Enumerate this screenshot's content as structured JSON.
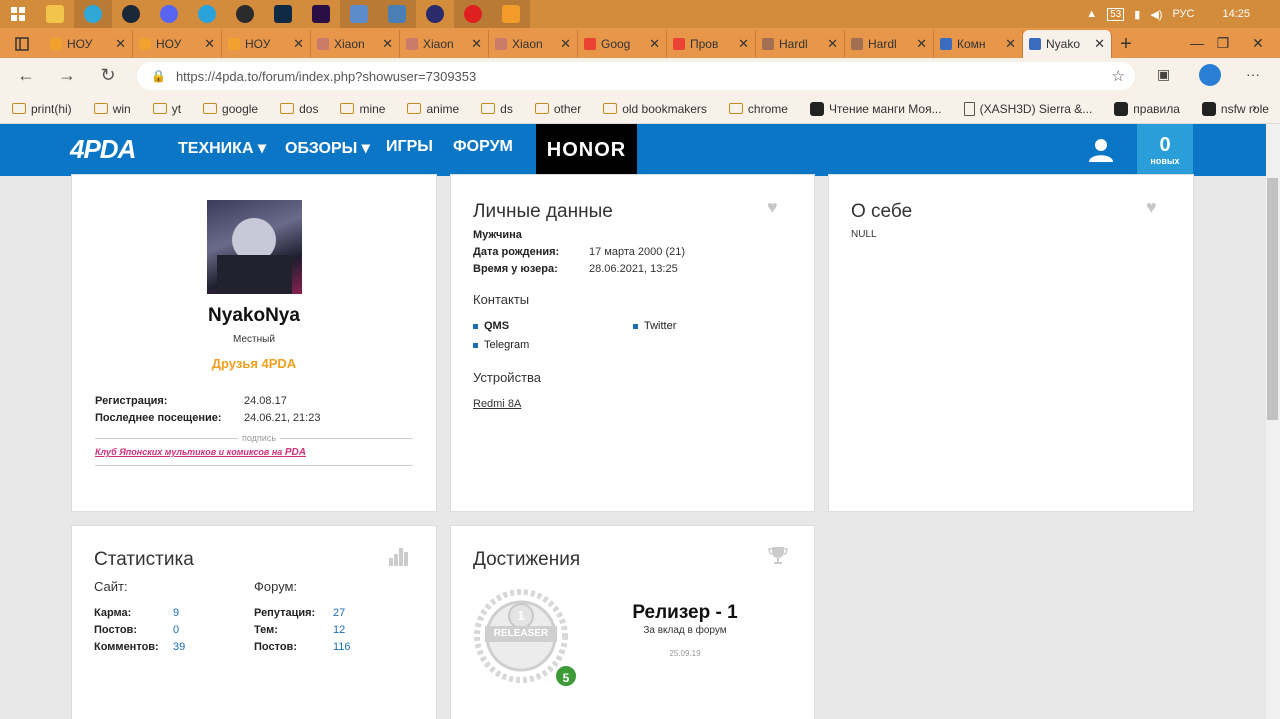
{
  "taskbar": {
    "lang": "РУС",
    "time": "14:25",
    "battery": "53"
  },
  "tabs": [
    {
      "label": "НОУ",
      "color": "#f2a12f"
    },
    {
      "label": "НОУ",
      "color": "#f2a12f"
    },
    {
      "label": "НОУ",
      "color": "#f2a12f"
    },
    {
      "label": "Xiaon",
      "color": "#c97b6a"
    },
    {
      "label": "Xiaon",
      "color": "#c97b6a"
    },
    {
      "label": "Xiaon",
      "color": "#c97b6a"
    },
    {
      "label": "Goog",
      "color": "#ea4335"
    },
    {
      "label": "Пров",
      "color": "#ea4335"
    },
    {
      "label": "Hardl",
      "color": "#a07050"
    },
    {
      "label": "Hardl",
      "color": "#a07050"
    },
    {
      "label": "Комн",
      "color": "#3a6bbf"
    },
    {
      "label": "Nyako",
      "color": "#3a6bbf"
    }
  ],
  "browser": {
    "url": "https://4pda.to/forum/index.php?showuser=7309353"
  },
  "bookmarks": [
    {
      "label": "print(hi)",
      "type": "folder"
    },
    {
      "label": "win",
      "type": "folder"
    },
    {
      "label": "yt",
      "type": "folder"
    },
    {
      "label": "google",
      "type": "folder"
    },
    {
      "label": "dos",
      "type": "folder"
    },
    {
      "label": "mine",
      "type": "folder"
    },
    {
      "label": "anime",
      "type": "folder"
    },
    {
      "label": "ds",
      "type": "folder"
    },
    {
      "label": "other",
      "type": "folder"
    },
    {
      "label": "old bookmakers",
      "type": "folder"
    },
    {
      "label": "chrome",
      "type": "folder"
    },
    {
      "label": "Чтение манги Моя...",
      "type": "site"
    },
    {
      "label": "(XASH3D) Sierra &...",
      "type": "page"
    },
    {
      "label": "правила",
      "type": "site"
    },
    {
      "label": "nsfw role",
      "type": "site"
    }
  ],
  "site": {
    "logo": "4PDA",
    "nav": [
      "ТЕХНИКА",
      "ОБЗОРЫ",
      "ИГРЫ",
      "ФОРУМ"
    ],
    "honor": "HONOR",
    "notif_count": "0",
    "notif_label": "новых"
  },
  "profile": {
    "username": "NyakoNya",
    "rank": "Местный",
    "group": "Друзья 4PDA",
    "reg_label": "Регистрация:",
    "reg_value": "24.08.17",
    "last_label": "Последнее посещение:",
    "last_value": "24.06.21, 21:23",
    "sig_label": "подпись",
    "signature": "Клуб Японских мультиков и комиксов на",
    "sig_logo": "PDA"
  },
  "personal": {
    "title": "Личные данные",
    "gender": "Мужчина",
    "bday_label": "Дата рождения:",
    "bday_value": "17 марта 2000 (21)",
    "time_label": "Время у юзера:",
    "time_value": "28.06.2021, 13:25",
    "contacts_title": "Контакты",
    "contacts": [
      "QMS",
      "Twitter",
      "Telegram"
    ],
    "devices_title": "Устройства",
    "device": "Redmi 8A"
  },
  "about": {
    "title": "О себе",
    "text": "NULL"
  },
  "stats": {
    "title": "Статистика",
    "site_label": "Сайт:",
    "forum_label": "Форум:",
    "site": [
      {
        "k": "Карма:",
        "v": "9"
      },
      {
        "k": "Постов:",
        "v": "0"
      },
      {
        "k": "Комментов:",
        "v": "39"
      }
    ],
    "forum": [
      {
        "k": "Репутация:",
        "v": "27"
      },
      {
        "k": "Тем:",
        "v": "12"
      },
      {
        "k": "Постов:",
        "v": "116"
      }
    ]
  },
  "achievements": {
    "title": "Достижения",
    "badge_num": "1",
    "badge_text": "RELEASER",
    "count": "5",
    "name": "Релизер - 1",
    "desc": "За вклад в форум",
    "date": "25.09.19"
  }
}
